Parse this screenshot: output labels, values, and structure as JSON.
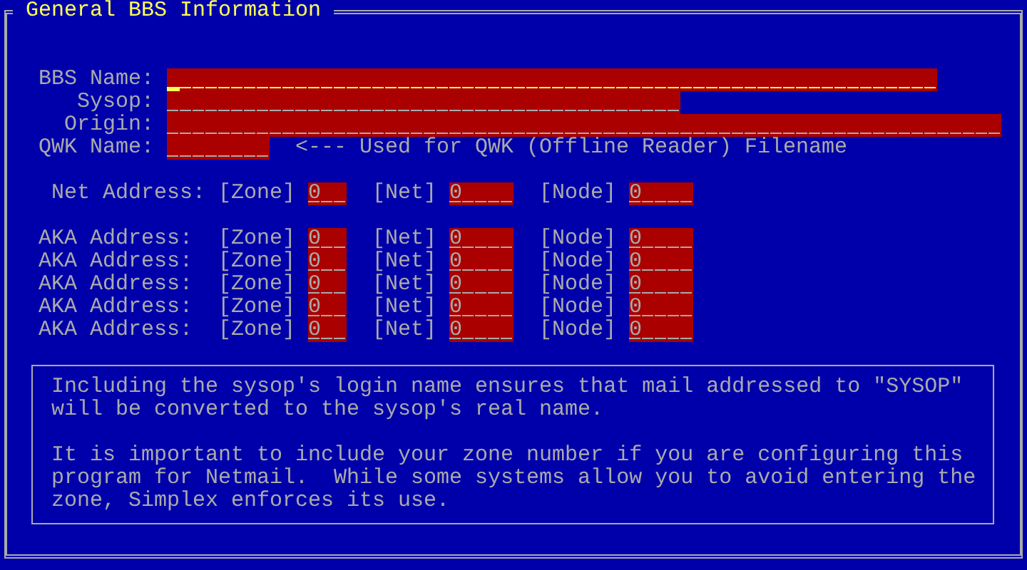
{
  "window": {
    "title": "General BBS Information"
  },
  "fields": [
    {
      "label": "BBS Name:",
      "focused": true
    },
    {
      "label": "Sysop:",
      "focused": false
    },
    {
      "label": "Origin:",
      "focused": false
    },
    {
      "label": "QWK Name:",
      "focused": false,
      "note": "<--- Used for QWK (Offline Reader) Filename"
    }
  ],
  "net_address": {
    "label": "Net Address:",
    "zone_label": "[Zone]",
    "zone": "0",
    "net_label": "[Net]",
    "net": "0",
    "node_label": "[Node]",
    "node": "0"
  },
  "aka_addresses": [
    {
      "label": "AKA Address:",
      "zone_label": "[Zone]",
      "zone": "0",
      "net_label": "[Net]",
      "net": "0",
      "node_label": "[Node]",
      "node": "0"
    },
    {
      "label": "AKA Address:",
      "zone_label": "[Zone]",
      "zone": "0",
      "net_label": "[Net]",
      "net": "0",
      "node_label": "[Node]",
      "node": "0"
    },
    {
      "label": "AKA Address:",
      "zone_label": "[Zone]",
      "zone": "0",
      "net_label": "[Net]",
      "net": "0",
      "node_label": "[Node]",
      "node": "0"
    },
    {
      "label": "AKA Address:",
      "zone_label": "[Zone]",
      "zone": "0",
      "net_label": "[Net]",
      "net": "0",
      "node_label": "[Node]",
      "node": "0"
    },
    {
      "label": "AKA Address:",
      "zone_label": "[Zone]",
      "zone": "0",
      "net_label": "[Net]",
      "net": "0",
      "node_label": "[Node]",
      "node": "0"
    }
  ],
  "help": [
    "Including the sysop's login name ensures that mail addressed to \"SYSOP\" will be converted to the sysop's real name.",
    "It is important to include your zone number if you are configuring this program for Netmail.  While some systems allow you to avoid entering the zone, Simplex enforces its use."
  ]
}
